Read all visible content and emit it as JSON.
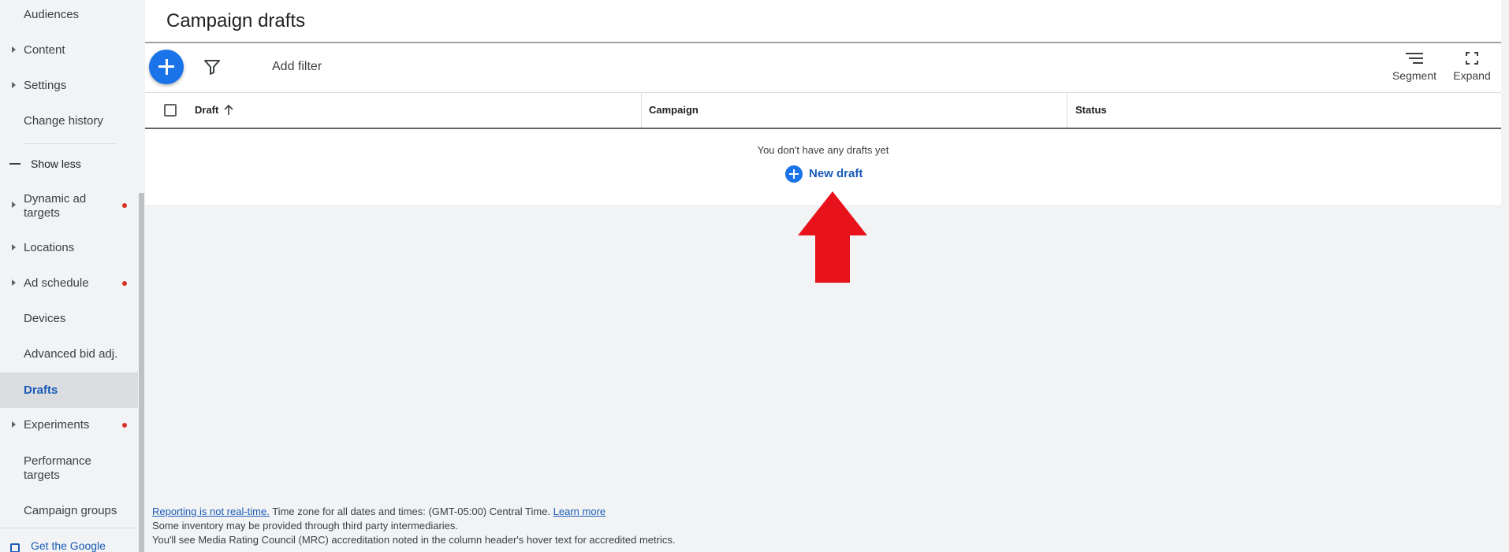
{
  "sidebar": {
    "items": [
      {
        "label": "Audiences",
        "expandable": false,
        "dot": false
      },
      {
        "label": "Content",
        "expandable": true,
        "dot": false
      },
      {
        "label": "Settings",
        "expandable": true,
        "dot": false
      },
      {
        "label": "Change history",
        "expandable": false,
        "dot": false
      }
    ],
    "show_less": "Show less",
    "more_items": [
      {
        "label": "Dynamic ad targets",
        "expandable": true,
        "dot": true
      },
      {
        "label": "Locations",
        "expandable": true,
        "dot": false
      },
      {
        "label": "Ad schedule",
        "expandable": true,
        "dot": true
      },
      {
        "label": "Devices",
        "expandable": false,
        "dot": false
      },
      {
        "label": "Advanced bid adj.",
        "expandable": false,
        "dot": false
      },
      {
        "label": "Drafts",
        "expandable": false,
        "dot": false,
        "active": true
      },
      {
        "label": "Experiments",
        "expandable": true,
        "dot": true
      },
      {
        "label": "Performance targets",
        "expandable": false,
        "dot": false
      },
      {
        "label": "Campaign groups",
        "expandable": false,
        "dot": false
      }
    ],
    "get_google": "Get the Google"
  },
  "main": {
    "title": "Campaign drafts",
    "toolbar": {
      "add_filter": "Add filter",
      "segment": "Segment",
      "expand": "Expand"
    },
    "table": {
      "columns": [
        "Draft",
        "Campaign",
        "Status"
      ],
      "sort_column": "Draft",
      "sort_direction": "ascending",
      "empty_message": "You don't have any drafts yet",
      "new_draft": "New draft"
    }
  },
  "footer": {
    "reporting_link": "Reporting is not real-time.",
    "timezone_text": " Time zone for all dates and times: (GMT-05:00) Central Time. ",
    "learn_more": "Learn more",
    "line2": "Some inventory may be provided through third party intermediaries.",
    "line3": "You'll see Media Rating Council (MRC) accreditation noted in the column header's hover text for accredited metrics."
  },
  "colors": {
    "accent": "#1a73e8",
    "link": "#1a5bb8",
    "alert_dot": "#d93025",
    "annotation_arrow": "#e8121c"
  }
}
